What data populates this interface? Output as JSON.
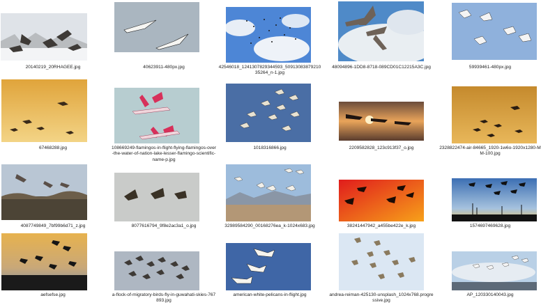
{
  "files": [
    {
      "name": "20140219_20RHAGEE.jpg",
      "scene": "geese-snow"
    },
    {
      "name": "40623911-480px.jpg",
      "scene": "cranes-grey-sky"
    },
    {
      "name": "42546018_1241307829344593_5091308387921035264_n-1.jpg",
      "scene": "flock-blue-clouds"
    },
    {
      "name": "48094896-1DD8-8718-089CD01C12215A3C.jpg",
      "scene": "cranes-clouds"
    },
    {
      "name": "59939461-480px.jpg",
      "scene": "geese-blue-sky"
    },
    {
      "name": "67468288.jpg",
      "scene": "birds-golden-sky"
    },
    {
      "name": "108669249-flamingos-in-flight-flying-flamingos-over-the-water-of-nation-lake-lesser-flamingo-scientific-name-p.jpg",
      "scene": "flamingos"
    },
    {
      "name": "1018316866.jpg",
      "scene": "flock-deep-blue"
    },
    {
      "name": "2209582828_123c913f37_o.jpg",
      "scene": "birds-sunset"
    },
    {
      "name": "2328822474-air-84665_1920-1w6o-1920x1280-MM-100.jpg",
      "scene": "birds-amber-sky"
    },
    {
      "name": "4087749849_7bf99b6d71_z.jpg",
      "scene": "cranes-tree-line"
    },
    {
      "name": "8077616794_9f8e2ac3a1_o.jpg",
      "scene": "geese-grey"
    },
    {
      "name": "32989584290_00168276ea_k-1024x683.jpg",
      "scene": "flock-mountains"
    },
    {
      "name": "38241447942_a455be422e_k.jpg",
      "scene": "silhouettes-red"
    },
    {
      "name": "1574697469628.jpg",
      "scene": "silhouettes-marsh"
    },
    {
      "name": "aefsefse.jpg",
      "scene": "silhouettes-dusk"
    },
    {
      "name": "a-flock-of-migratory-birds-fly-in-guwahati-skies-767893.jpg",
      "scene": "flock-pale"
    },
    {
      "name": "american-white-pelicans-in-flight.jpg",
      "scene": "pelicans-blue"
    },
    {
      "name": "andrea-reiman-425130-unsplash_1024x768.progressive.jpg",
      "scene": "birds-light-sky"
    },
    {
      "name": "AP_120330140043.jpg",
      "scene": "flock-low-clouds"
    }
  ]
}
